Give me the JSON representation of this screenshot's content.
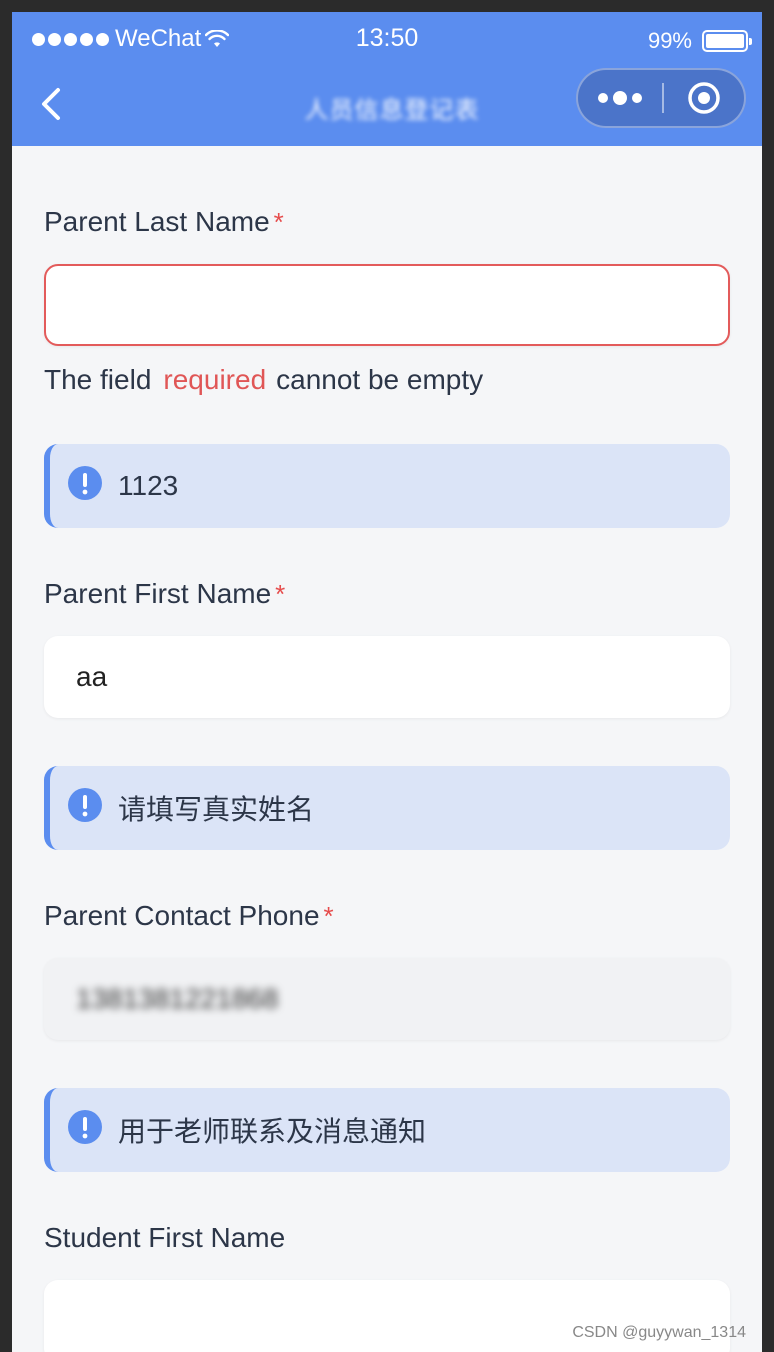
{
  "status_bar": {
    "carrier": "WeChat",
    "time": "13:50",
    "battery": "99%"
  },
  "nav": {
    "title": "人员信息登记表",
    "back_icon": "chevron-left-icon",
    "menu_icon": "more-dots-icon",
    "close_icon": "target-circle-icon"
  },
  "form": {
    "parent_last_name": {
      "label": "Parent Last Name",
      "required_mark": "*",
      "value": "",
      "error_prefix": "The field",
      "error_key": "required",
      "error_suffix": "cannot be empty",
      "notice": "1123"
    },
    "parent_first_name": {
      "label": "Parent First Name",
      "required_mark": "*",
      "value": "aa",
      "notice": "请填写真实姓名"
    },
    "parent_contact_phone": {
      "label": "Parent Contact Phone",
      "required_mark": "*",
      "value": "1381381221868",
      "notice": "用于老师联系及消息通知"
    },
    "student_first_name": {
      "label": "Student First Name",
      "value": ""
    }
  },
  "colors": {
    "primary": "#5b8def",
    "error": "#e35b5b",
    "notice_bg": "#dbe4f7"
  },
  "watermark": "CSDN @guyywan_1314"
}
